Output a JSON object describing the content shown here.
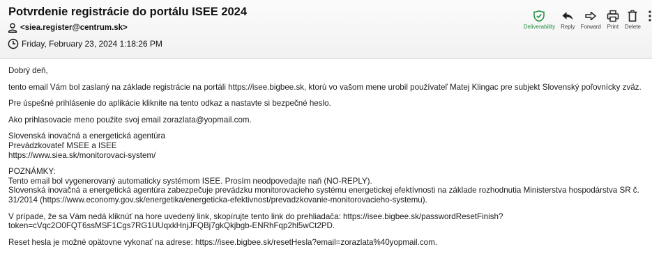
{
  "email": {
    "subject": "Potvrdenie registrácie do portálu ISEE 2024",
    "sender": "<siea.register@centrum.sk>",
    "date": "Friday, February 23, 2024 1:18:26 PM"
  },
  "toolbar": {
    "deliverability": "Deliverability",
    "reply": "Reply",
    "forward": "Forward",
    "print": "Print",
    "delete": "Delete"
  },
  "colors": {
    "accent_green": "#1e8e3e",
    "header_bg": "#f3f3f3"
  },
  "body": {
    "greeting": "Dobrý deň,",
    "p1": "tento email Vám bol zaslaný na základe registrácie na portáli https://isee.bigbee.sk, ktorú vo vašom mene urobil používateľ Matej Klingac pre subjekt Slovenský poľovnícky zväz.",
    "p2": "Pre úspešné prihlásenie do aplikácie kliknite na tento odkaz a nastavte si bezpečné heslo.",
    "p3": "Ako prihlasovacie meno použite svoj email zorazlata@yopmail.com.",
    "signature": [
      "Slovenská inovačná a energetická agentúra",
      "Prevádzkovateľ MSEE a ISEE",
      "https://www.siea.sk/monitorovaci-system/"
    ],
    "notes": [
      "POZNÁMKY:",
      "Tento email bol vygenerovaný automaticky systémom ISEE. Prosím neodpovedajte naň (NO-REPLY).",
      "Slovenská inovačná a energetická agentúra zabezpečuje prevádzku monitorovacieho systému energetickej efektívnosti na základe rozhodnutia Ministerstva hospodárstva SR č.",
      "31/2014 (https://www.economy.gov.sk/energetika/energeticka-efektivnost/prevadzkovanie-monitorovacieho-systemu)."
    ],
    "link_note": [
      "V prípade, že sa Vám nedá kliknúť na hore uvedený link, skopírujte tento link do prehliadača: https://isee.bigbee.sk/passwordResetFinish?",
      "token=cVqc2O0FQT6ssMSF1Cgs7RG1UUqxkHnjJFQBj7gkQkjbgb-ENRhFqp2hl5wCt2PD."
    ],
    "reset": "Reset hesla je možné opätovne vykonať na adrese: https://isee.bigbee.sk/resetHesla?email=zorazlata%40yopmail.com."
  }
}
